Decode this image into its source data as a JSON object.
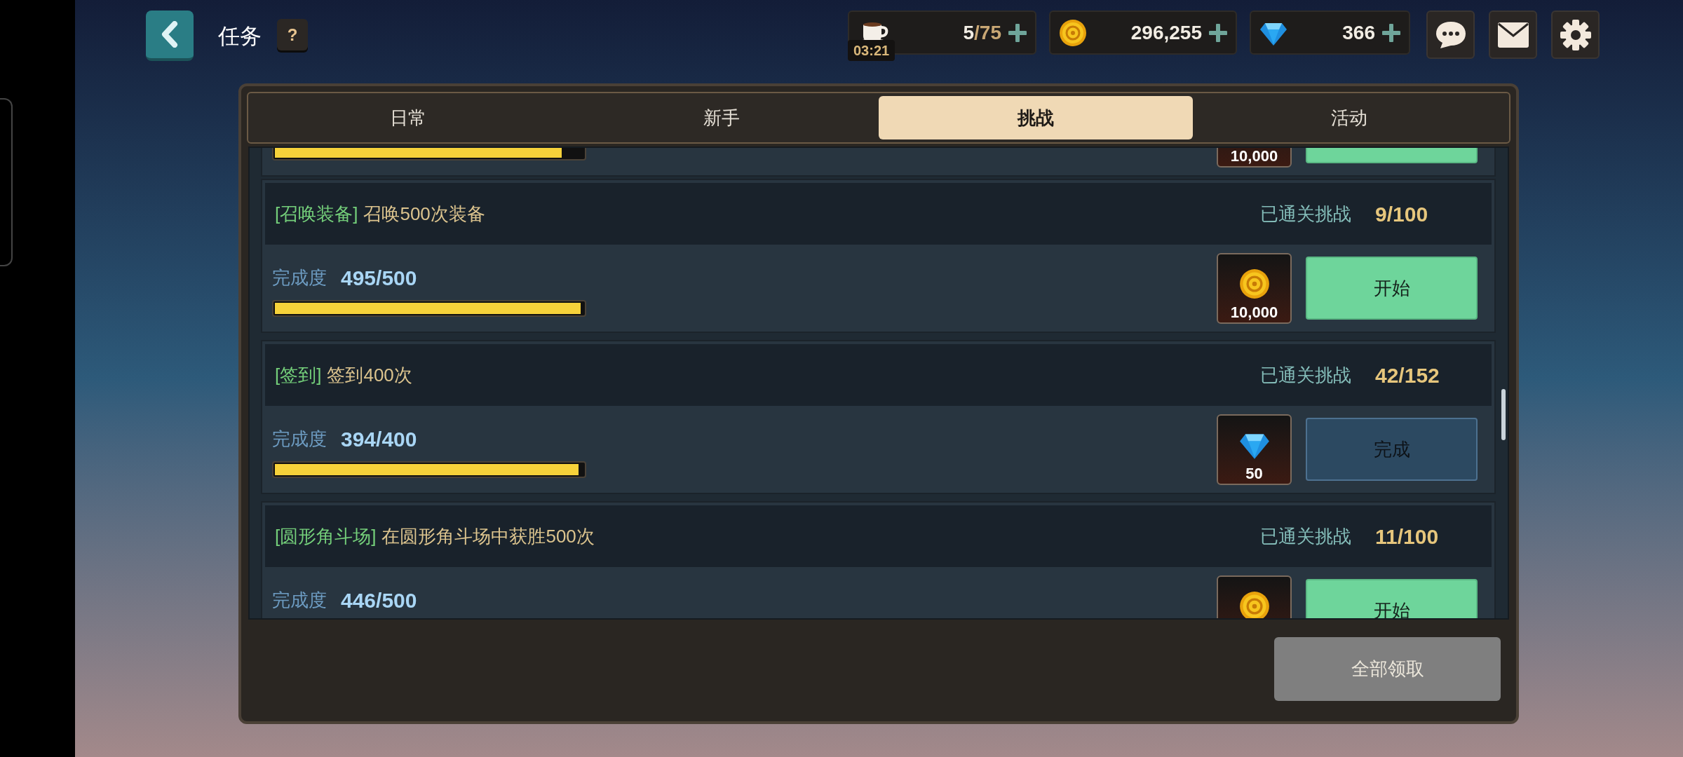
{
  "header": {
    "title": "任务",
    "help": "?"
  },
  "resources": [
    {
      "kind": "stamina",
      "value": "5",
      "max": "/75",
      "timer": "03:21"
    },
    {
      "kind": "coin",
      "value": "296,255"
    },
    {
      "kind": "gem",
      "value": "366"
    }
  ],
  "tabs": [
    {
      "label": "日常",
      "selected": false
    },
    {
      "label": "新手",
      "selected": false
    },
    {
      "label": "挑战",
      "selected": true
    },
    {
      "label": "活动",
      "selected": false
    }
  ],
  "tasks": [
    {
      "level": 0.93,
      "reward": {
        "amount": "10,000"
      },
      "button": {
        "kind": "start"
      }
    },
    {
      "category": "[召唤装备]",
      "title": "召唤500次装备",
      "cleared_label": "已通关挑战",
      "cleared_count": "9/100",
      "progress_label": "完成度",
      "progress": "495/500",
      "level": 0.99,
      "reward": {
        "kind": "coin",
        "amount": "10,000"
      },
      "button": {
        "kind": "start",
        "label": "开始"
      }
    },
    {
      "category": "[签到]",
      "title": "签到400次",
      "cleared_label": "已通关挑战",
      "cleared_count": "42/152",
      "progress_label": "完成度",
      "progress": "394/400",
      "level": 0.985,
      "reward": {
        "kind": "gem",
        "amount": "50"
      },
      "button": {
        "kind": "done",
        "label": "完成"
      }
    },
    {
      "category": "[圆形角斗场]",
      "title": "在圆形角斗场中获胜500次",
      "cleared_label": "已通关挑战",
      "cleared_count": "11/100",
      "progress_label": "完成度",
      "progress": "446/500",
      "reward": {
        "kind": "coin"
      },
      "button": {
        "kind": "start",
        "label": "开始"
      }
    }
  ],
  "claim_all": {
    "label": "全部领取",
    "disabled": true
  }
}
